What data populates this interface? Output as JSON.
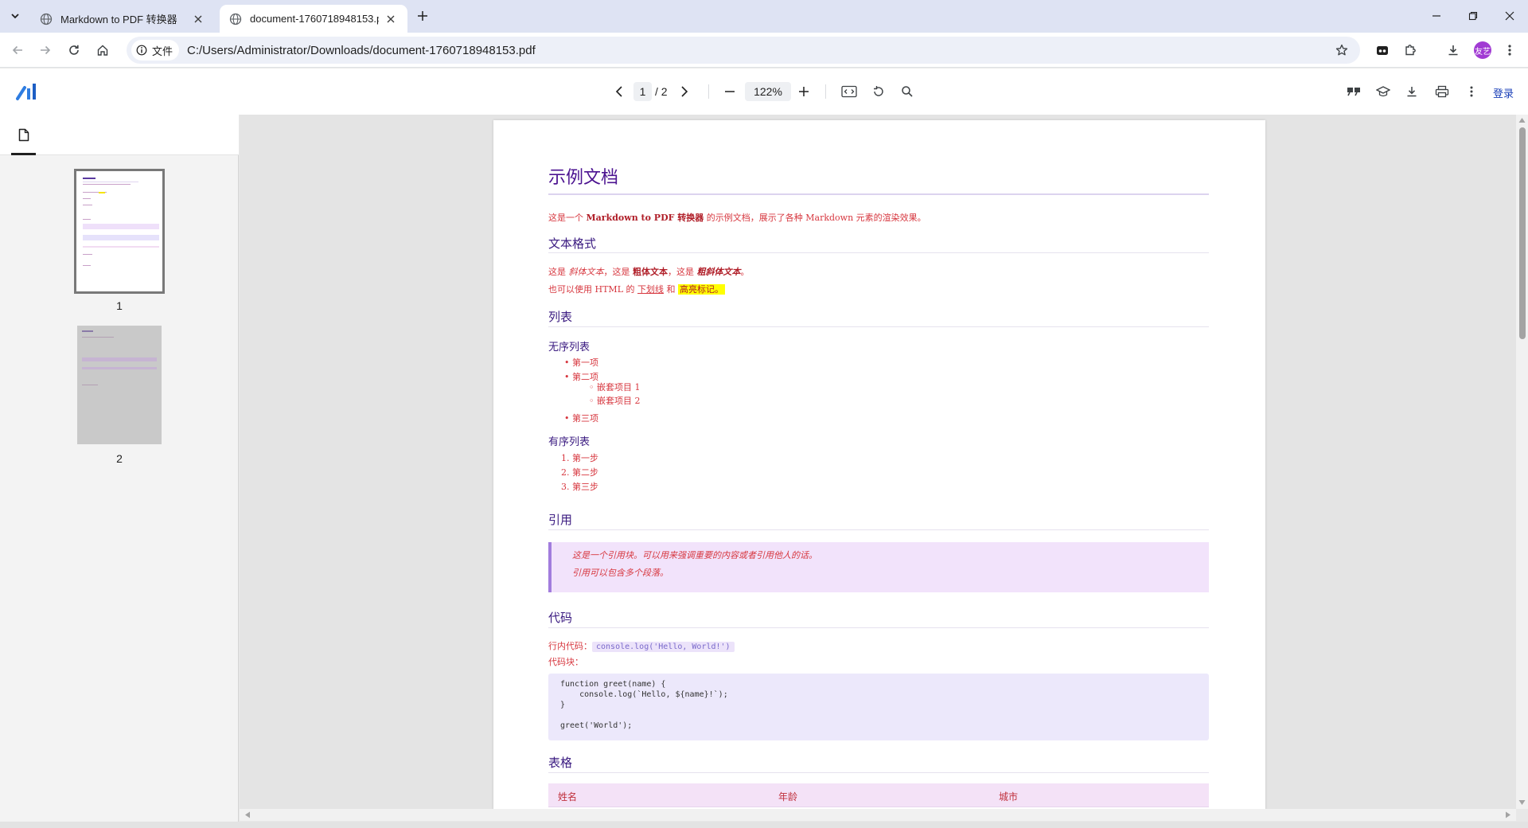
{
  "browser": {
    "tabs": [
      {
        "title": "Markdown to PDF 转换器",
        "active": false
      },
      {
        "title": "document-1760718948153.pdf",
        "active": true
      }
    ],
    "site_info_label": "文件",
    "url": "C:/Users/Administrator/Downloads/document-1760718948153.pdf",
    "avatar_text": "友艺"
  },
  "viewer": {
    "current_page": "1",
    "total_pages": "/ 2",
    "zoom": "122%",
    "login_label": "登录"
  },
  "sidebar": {
    "thumbnails": [
      {
        "label": "1"
      },
      {
        "label": "2"
      }
    ]
  },
  "document": {
    "title": "示例文档",
    "intro": {
      "prefix": "这是一个 ",
      "bold": "Markdown to PDF 转换器",
      "suffix": " 的示例文档，展示了各种 Markdown 元素的渲染效果。"
    },
    "sec_text_format": "文本格式",
    "format_line": {
      "p1": "这是 ",
      "italic": "斜体文本",
      "p2": "，这是 ",
      "bold": "粗体文本",
      "p3": "，这是 ",
      "bold_italic": "粗斜体文本",
      "p4": "。"
    },
    "html_line": {
      "p1": "也可以使用 HTML 的 ",
      "underline": "下划线",
      "p2": " 和 ",
      "highlight": "高亮标记。"
    },
    "sec_lists": "列表",
    "unordered_heading": "无序列表",
    "unordered_items": [
      "第一项",
      "第二项",
      "嵌套项目 1",
      "嵌套项目 2",
      "第三项"
    ],
    "ordered_heading": "有序列表",
    "ordered_items": [
      "第一步",
      "第二步",
      "第三步"
    ],
    "ordered_numbers": [
      "1.",
      "2.",
      "3."
    ],
    "sec_quote": "引用",
    "quote_lines": [
      "这是一个引用块。可以用来强调重要的内容或者引用他人的话。",
      "引用可以包含多个段落。"
    ],
    "sec_code": "代码",
    "inline_code_label": "行内代码：",
    "inline_code": "console.log('Hello, World!')",
    "code_block_label": "代码块：",
    "code_lines": [
      "function greet(name) {",
      "    console.log(`Hello, ${name}!`);",
      "}",
      "",
      "greet('World');"
    ],
    "sec_table": "表格",
    "table_headers": [
      "姓名",
      "年龄",
      "城市"
    ]
  }
}
